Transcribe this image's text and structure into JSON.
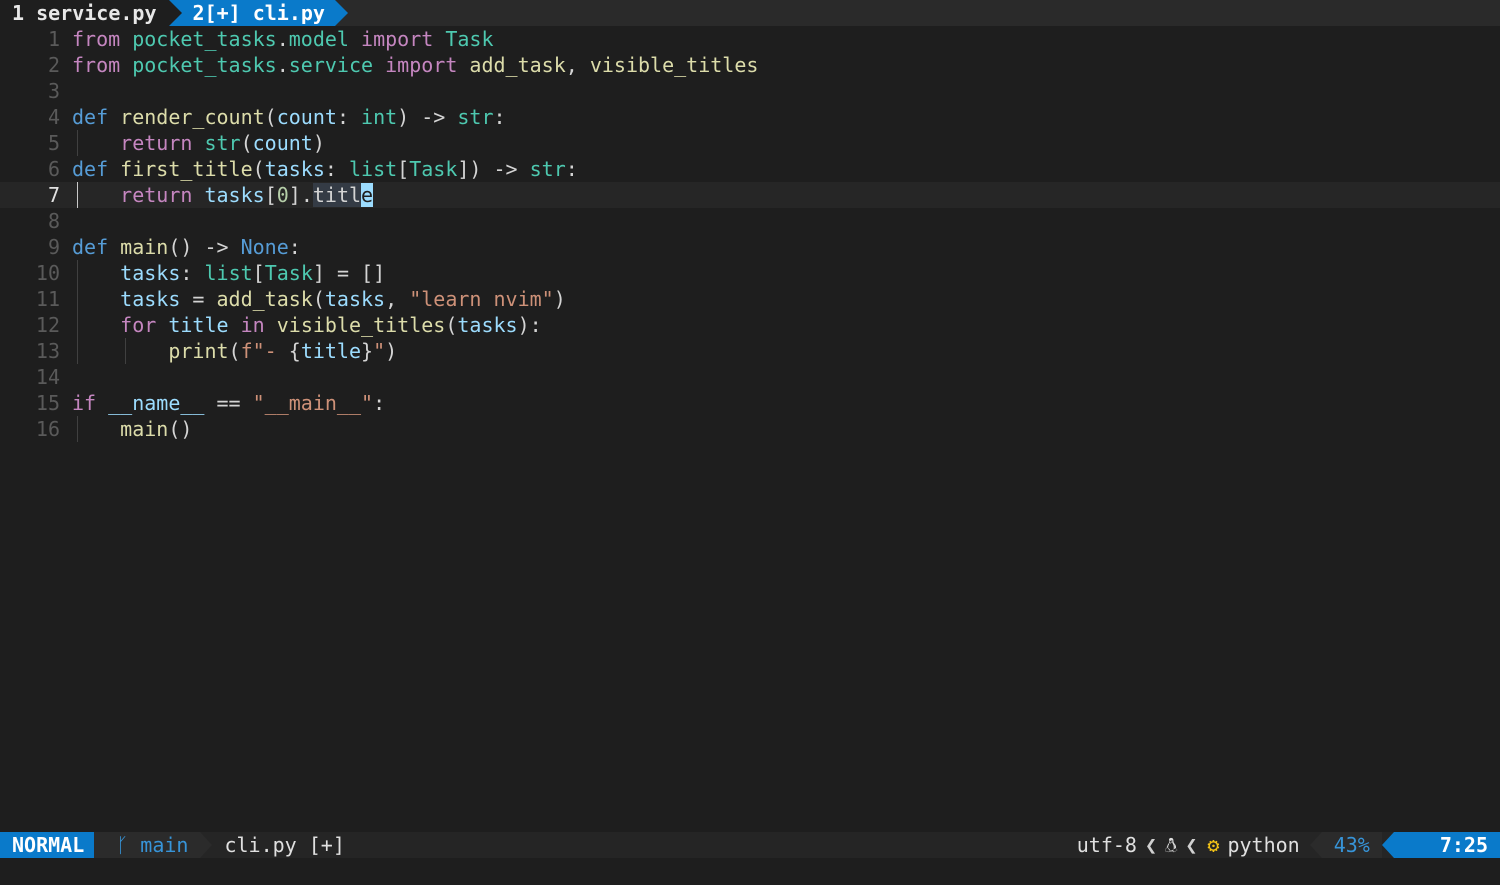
{
  "tabline": {
    "tabs": [
      {
        "label": "1 service.py",
        "active": false
      },
      {
        "label": "2[+] cli.py",
        "active": true
      }
    ]
  },
  "editor": {
    "cursor_line": 7,
    "lines": [
      {
        "num": "1",
        "tokens": [
          [
            "kw",
            "from"
          ],
          [
            "plain",
            " "
          ],
          [
            "mod",
            "pocket_tasks"
          ],
          [
            "plain",
            "."
          ],
          [
            "mod",
            "model"
          ],
          [
            "plain",
            " "
          ],
          [
            "kw",
            "import"
          ],
          [
            "plain",
            " "
          ],
          [
            "ty",
            "Task"
          ]
        ]
      },
      {
        "num": "2",
        "tokens": [
          [
            "kw",
            "from"
          ],
          [
            "plain",
            " "
          ],
          [
            "mod",
            "pocket_tasks"
          ],
          [
            "plain",
            "."
          ],
          [
            "mod",
            "service"
          ],
          [
            "plain",
            " "
          ],
          [
            "kw",
            "import"
          ],
          [
            "plain",
            " "
          ],
          [
            "fn",
            "add_task"
          ],
          [
            "plain",
            ", "
          ],
          [
            "fn",
            "visible_titles"
          ]
        ]
      },
      {
        "num": "3",
        "tokens": []
      },
      {
        "num": "4",
        "tokens": [
          [
            "def",
            "def"
          ],
          [
            "plain",
            " "
          ],
          [
            "fn",
            "render_count"
          ],
          [
            "pun",
            "("
          ],
          [
            "var",
            "count"
          ],
          [
            "pun",
            ": "
          ],
          [
            "bi",
            "int"
          ],
          [
            "pun",
            ") -> "
          ],
          [
            "bi",
            "str"
          ],
          [
            "pun",
            ":"
          ]
        ]
      },
      {
        "num": "5",
        "guides": [
          0
        ],
        "tokens": [
          [
            "plain",
            "    "
          ],
          [
            "kw",
            "return"
          ],
          [
            "plain",
            " "
          ],
          [
            "bi",
            "str"
          ],
          [
            "pun",
            "("
          ],
          [
            "var",
            "count"
          ],
          [
            "pun",
            ")"
          ]
        ]
      },
      {
        "num": "6",
        "tokens": [
          [
            "def",
            "def"
          ],
          [
            "plain",
            " "
          ],
          [
            "fn",
            "first_title"
          ],
          [
            "pun",
            "("
          ],
          [
            "var",
            "tasks"
          ],
          [
            "pun",
            ": "
          ],
          [
            "bi",
            "list"
          ],
          [
            "pun",
            "["
          ],
          [
            "ty",
            "Task"
          ],
          [
            "pun",
            "]) -> "
          ],
          [
            "bi",
            "str"
          ],
          [
            "pun",
            ":"
          ]
        ]
      },
      {
        "num": "7",
        "guides": [
          0
        ],
        "active_guide": true,
        "tokens": [
          [
            "plain",
            "    "
          ],
          [
            "kw",
            "return"
          ],
          [
            "plain",
            " "
          ],
          [
            "var",
            "tasks"
          ],
          [
            "pun",
            "["
          ],
          [
            "num",
            "0"
          ],
          [
            "pun",
            "]."
          ],
          [
            "hl",
            "titl"
          ],
          [
            "cursor",
            "e"
          ]
        ]
      },
      {
        "num": "8",
        "tokens": []
      },
      {
        "num": "9",
        "tokens": [
          [
            "def",
            "def"
          ],
          [
            "plain",
            " "
          ],
          [
            "fn",
            "main"
          ],
          [
            "pun",
            "() -> "
          ],
          [
            "con",
            "None"
          ],
          [
            "pun",
            ":"
          ]
        ]
      },
      {
        "num": "10",
        "guides": [
          0
        ],
        "tokens": [
          [
            "plain",
            "    "
          ],
          [
            "var",
            "tasks"
          ],
          [
            "pun",
            ": "
          ],
          [
            "bi",
            "list"
          ],
          [
            "pun",
            "["
          ],
          [
            "ty",
            "Task"
          ],
          [
            "pun",
            "] = []"
          ]
        ]
      },
      {
        "num": "11",
        "guides": [
          0
        ],
        "tokens": [
          [
            "plain",
            "    "
          ],
          [
            "var",
            "tasks"
          ],
          [
            "pun",
            " = "
          ],
          [
            "fn",
            "add_task"
          ],
          [
            "pun",
            "("
          ],
          [
            "var",
            "tasks"
          ],
          [
            "pun",
            ", "
          ],
          [
            "str",
            "\"learn nvim\""
          ],
          [
            "pun",
            ")"
          ]
        ]
      },
      {
        "num": "12",
        "guides": [
          0
        ],
        "tokens": [
          [
            "plain",
            "    "
          ],
          [
            "kw",
            "for"
          ],
          [
            "plain",
            " "
          ],
          [
            "var",
            "title"
          ],
          [
            "plain",
            " "
          ],
          [
            "kw",
            "in"
          ],
          [
            "plain",
            " "
          ],
          [
            "fn",
            "visible_titles"
          ],
          [
            "pun",
            "("
          ],
          [
            "var",
            "tasks"
          ],
          [
            "pun",
            "):"
          ]
        ]
      },
      {
        "num": "13",
        "guides": [
          0,
          4
        ],
        "tokens": [
          [
            "plain",
            "        "
          ],
          [
            "fn",
            "print"
          ],
          [
            "pun",
            "("
          ],
          [
            "str",
            "f\"- "
          ],
          [
            "pun",
            "{"
          ],
          [
            "var",
            "title"
          ],
          [
            "pun",
            "}"
          ],
          [
            "str",
            "\""
          ],
          [
            "pun",
            ")"
          ]
        ]
      },
      {
        "num": "14",
        "tokens": []
      },
      {
        "num": "15",
        "tokens": [
          [
            "kw",
            "if"
          ],
          [
            "plain",
            " "
          ],
          [
            "var",
            "__name__"
          ],
          [
            "pun",
            " == "
          ],
          [
            "str",
            "\"__main__\""
          ],
          [
            "pun",
            ":"
          ]
        ]
      },
      {
        "num": "16",
        "guides": [
          0
        ],
        "tokens": [
          [
            "plain",
            "    "
          ],
          [
            "fn",
            "main"
          ],
          [
            "pun",
            "()"
          ]
        ]
      }
    ]
  },
  "statusline": {
    "mode": "NORMAL",
    "branch_icon": "git-branch-icon",
    "branch": "main",
    "filename": "cli.py [+]",
    "encoding": "utf-8",
    "os_icon": "linux-tux-icon",
    "python_icon": "python-icon",
    "filetype": "python",
    "percent": "43%",
    "position": "7:25"
  }
}
